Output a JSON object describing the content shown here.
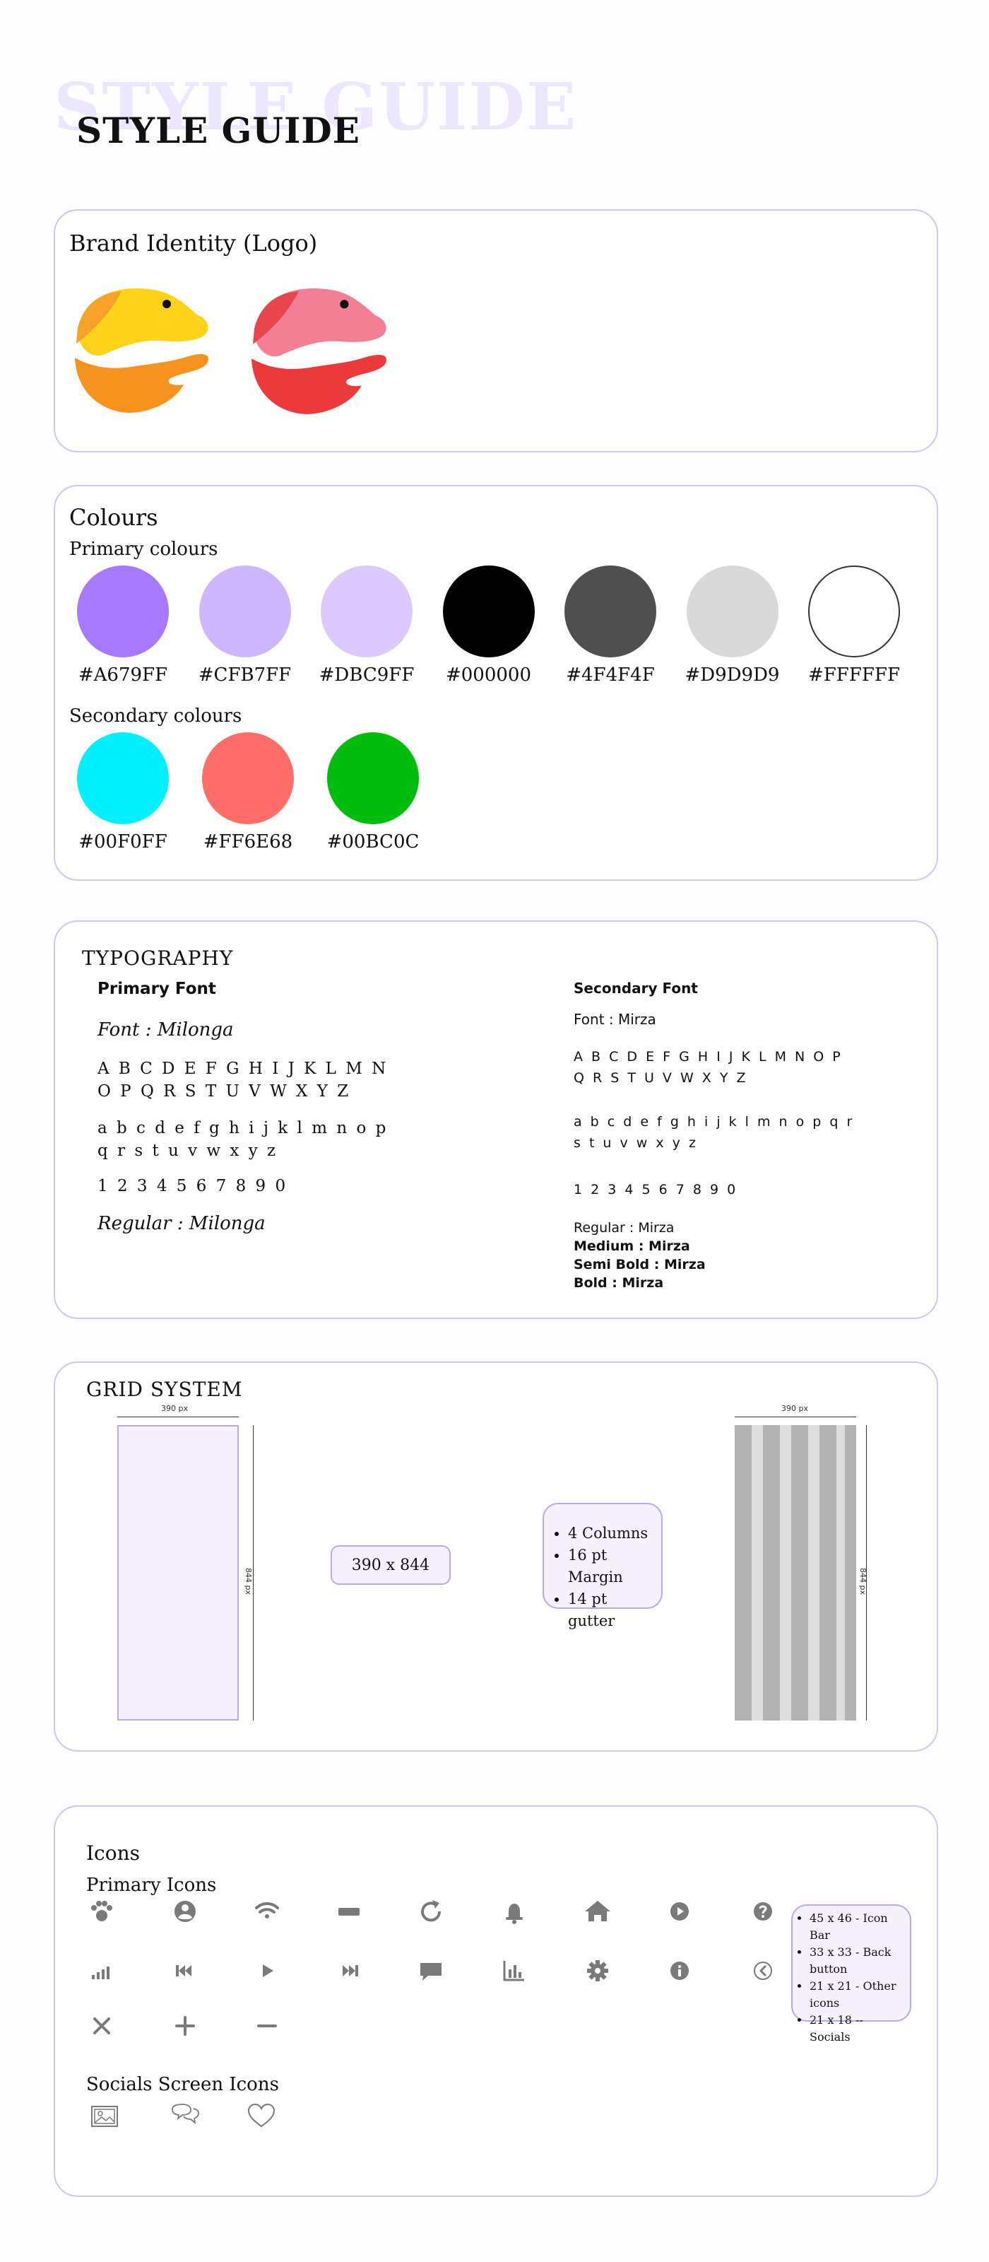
{
  "page": {
    "ghost_title": "STYLE GUIDE",
    "title": "STYLE GUIDE"
  },
  "brand": {
    "title": "Brand Identity (Logo)",
    "logos": [
      {
        "name": "yellow-orange-logo",
        "colors": [
          "#FFD31A",
          "#F7A126",
          "#F6921E"
        ]
      },
      {
        "name": "pink-red-logo",
        "colors": [
          "#F27F93",
          "#E8454D",
          "#EC3A3C"
        ]
      }
    ]
  },
  "colours": {
    "title": "Colours",
    "primary_label": "Primary colours",
    "primary": [
      "#A679FF",
      "#CFB7FF",
      "#DBC9FF",
      "#000000",
      "#4F4F4F",
      "#D9D9D9",
      "#FFFFFF"
    ],
    "secondary_label": "Secondary colours",
    "secondary": [
      "#00F0FF",
      "#FF6E68",
      "#00BC0C"
    ]
  },
  "typography": {
    "title": "TYPOGRAPHY",
    "primary": {
      "heading": "Primary Font",
      "font_line": "Font : Milonga",
      "upper": "A B C D E F G H I J K L M N O P Q R S T U V W X Y Z",
      "lower": "a b c d e f g h i j k l m n o p q r s t u v w x y z",
      "digits": "1 2 3 4 5 6 7 8 9 0",
      "regular": "Regular : Milonga"
    },
    "secondary": {
      "heading": "Secondary Font",
      "font_line": "Font : Mirza",
      "upper": "A B C D E F G H I J K L M N O P Q R S T U V W X Y Z",
      "lower": "a b c d e f g h i j k l m n o p q r s t u v w x y z",
      "digits": "1 2 3 4 5 6 7 8 9 0",
      "weights": [
        "Regular : Mirza",
        "Medium : Mirza",
        "Semi Bold : Mirza",
        "Bold : Mirza"
      ]
    }
  },
  "grid": {
    "title": "GRID SYSTEM",
    "width_label": "390 px",
    "height_label": "844 px",
    "size_label": "390 x 844",
    "specs": [
      "4 Columns",
      "16 pt Margin",
      "14 pt gutter"
    ]
  },
  "icons": {
    "title": "Icons",
    "primary_label": "Primary Icons",
    "primary": [
      "paw-icon",
      "user-circle-icon",
      "wifi-icon",
      "battery-icon",
      "refresh-icon",
      "bell-icon",
      "home-icon",
      "play-circle-icon",
      "help-circle-icon",
      "signal-icon",
      "skip-back-icon",
      "play-icon",
      "skip-forward-icon",
      "chat-bubble-icon",
      "bar-chart-icon",
      "gear-icon",
      "info-icon",
      "back-circle-icon",
      "close-icon",
      "plus-icon",
      "minus-icon"
    ],
    "sizes": [
      "45 x 46 - Icon Bar",
      "33 x 33 - Back button",
      "21 x 21 - Other icons",
      "21 x 18 -- Socials"
    ],
    "social_label": "Socials Screen Icons",
    "social": [
      "image-icon",
      "chat-bubbles-icon",
      "heart-icon"
    ],
    "icon_color": "#7A7A7A"
  }
}
